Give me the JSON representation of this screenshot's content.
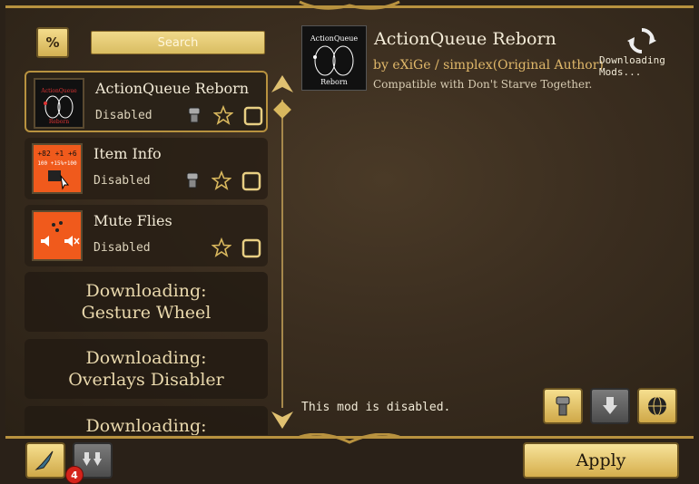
{
  "search": {
    "placeholder": "Search"
  },
  "mods": [
    {
      "name": "ActionQueue Reborn",
      "status": "Disabled",
      "thumb_title": "ActionQueue",
      "thumb_sub": "Reborn",
      "selected": true,
      "has_server_icon": true,
      "has_favorite": true,
      "has_checkbox": true
    },
    {
      "name": "Item Info",
      "status": "Disabled",
      "thumb_text_top": "+82 +1 +6",
      "thumb_text_mid": "100 +15%+100",
      "has_server_icon": true,
      "has_favorite": true,
      "has_checkbox": true
    },
    {
      "name": "Mute Flies",
      "status": "Disabled",
      "has_server_icon": false,
      "has_favorite": true,
      "has_checkbox": true
    }
  ],
  "downloading": [
    {
      "label": "Downloading:",
      "name": "Gesture Wheel"
    },
    {
      "label": "Downloading:",
      "name": "Overlays Disabler"
    },
    {
      "label": "Downloading:",
      "name": ""
    }
  ],
  "detail": {
    "title": "ActionQueue Reborn",
    "thumb_title": "ActionQueue",
    "thumb_sub": "Reborn",
    "author": "by eXiGe / simplex(Original Author)",
    "compat": "Compatible with Don't Starve Together.",
    "download_status": "Downloading Mods...",
    "disabled_message": "This mod is disabled."
  },
  "bottom": {
    "apply_label": "Apply",
    "updates_badge": "4"
  },
  "icons": [
    "filter-icon",
    "refresh-icon",
    "server-icon",
    "star-icon",
    "checkbox-icon",
    "scroll-up-icon",
    "scroll-down-icon",
    "config-icon",
    "update-icon",
    "globe-icon",
    "clean-icon",
    "updates-icon"
  ],
  "colors": {
    "accent": "#b8923f",
    "button_gold": "#e6c66a",
    "badge": "#d4231b"
  }
}
